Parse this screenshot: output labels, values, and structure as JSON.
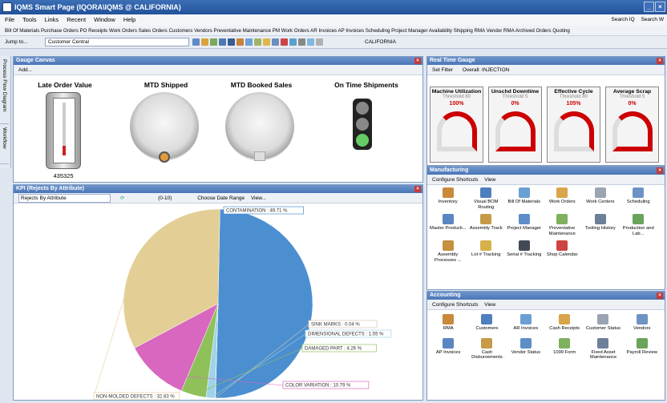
{
  "window": {
    "title": "IQMS Smart Page (IQORA\\IQMS @ CALIFORNIA)",
    "min": "_",
    "close": "×"
  },
  "menu": {
    "items": [
      "File",
      "Tools",
      "Links",
      "Recent",
      "Window",
      "Help"
    ],
    "search_iq": "Search IQ",
    "search_web": "Search W"
  },
  "quicklinks": "Bill Of Materials  Purchase Orders  PO Receipts  Work Orders  Sales Orders  Customers  Vendors  Preventative Maintenance  PM Work Orders  AR Invoices  AP Invoices  Scheduling  Project Manager  Availability  Shipping  RMA  Vendor RMA  Archived Orders  Quoting",
  "toolbar": {
    "jump": "Jump to...",
    "context": "Customer Central",
    "location": "CALIFORNIA"
  },
  "sidebar": {
    "tabs": [
      "Process Flow Diagram",
      "Workflow"
    ]
  },
  "gauge_canvas": {
    "title": "Gauge Canvas",
    "add": "Add...",
    "labels": [
      "Late Order Value",
      "MTD Shipped",
      "MTD Booked Sales",
      "On Time Shipments"
    ],
    "late_order_value": "435325"
  },
  "realtime": {
    "title": "Real Time Gauge",
    "set_filter": "Set Filter",
    "overall": "Overall: INJECTION",
    "gauges": [
      {
        "name": "Machine Utilization",
        "threshold": "Threshold 80",
        "value": "100%"
      },
      {
        "name": "Unschd Downtime",
        "threshold": "Threshold 5",
        "value": "0%"
      },
      {
        "name": "Effective Cycle",
        "threshold": "Threshold 80",
        "value": "105%"
      },
      {
        "name": "Average Scrap",
        "threshold": "Threshold 5",
        "value": "0%"
      }
    ]
  },
  "kpi": {
    "title": "KPI (Rejects By Attribute)",
    "select": "Rejects By Attribute",
    "range": "(0-10)",
    "date_range": "Choose Date Range",
    "view": "View..."
  },
  "chart_data": {
    "type": "pie",
    "categories": [
      "CONTAMINATION",
      "SINK MARKS",
      "DIMENSIONAL DEFECTS",
      "DAMAGED PART",
      "COLOR VARIATION",
      "NON-MOLDED DEFECTS"
    ],
    "values": [
      49.71,
      0.04,
      1.55,
      4.26,
      10.79,
      32.83
    ],
    "labels": [
      "CONTAMINATION    : 49.71 %",
      "SINK MARKS    : 0.04 %",
      "DIMENSIONAL DEFECTS : 1.55 %",
      "DAMAGED PART    : 4.26 %",
      "COLOR VARIATION    : 10.79 %",
      "NON-MOLDED DEFECTS : 32.83 %"
    ],
    "colors": [
      "#4b8fd0",
      "#d9c7ad",
      "#9fd3e8",
      "#8fc15a",
      "#d867bf",
      "#e3cf96"
    ]
  },
  "manufacturing": {
    "title": "Manufacturing",
    "configure": "Configure Shortcuts",
    "view": "View",
    "items": [
      "Inventory",
      "Visual BOM Routing",
      "Bill Of Materials",
      "Work Orders",
      "Work Centers",
      "Scheduling",
      "Master Producti...",
      "Assembly Track",
      "Project Manager",
      "Preventative Maintenance",
      "Tooling History",
      "Production and Lab...",
      "Assembly Processes ...",
      "Lot # Tracking",
      "Serial # Tracking",
      "Shop Calendar"
    ]
  },
  "accounting": {
    "title": "Accounting",
    "configure": "Configure Shortcuts",
    "view": "View",
    "items": [
      "RMA",
      "Customers",
      "AR Invoices",
      "Cash Receipts",
      "Customer Status",
      "Vendors",
      "AP Invoices",
      "Cash Disbursements",
      "Vendor Status",
      "1099 Form",
      "Fixed Asset Maintenance",
      "Payroll Review"
    ]
  }
}
